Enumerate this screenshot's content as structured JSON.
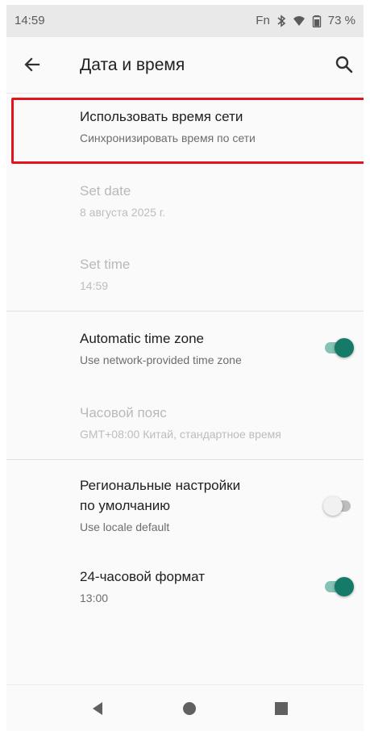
{
  "status_bar": {
    "time": "14:59",
    "fn_label": "Fn",
    "battery_percent": "73 %",
    "icons": [
      "bluetooth-icon",
      "wifi-icon",
      "battery-icon"
    ]
  },
  "toolbar": {
    "title": "Дата и время",
    "back_icon": "arrow-back-icon",
    "search_icon": "search-icon"
  },
  "settings": {
    "network_time": {
      "title": "Использовать время сети",
      "summary": "Синхронизировать время по сети"
    },
    "set_date": {
      "title": "Set date",
      "summary": "8 августа 2025 г.",
      "enabled": false
    },
    "set_time": {
      "title": "Set time",
      "summary": "14:59",
      "enabled": false
    },
    "auto_timezone": {
      "title": "Automatic time zone",
      "summary": "Use network-provided time zone",
      "checked": true
    },
    "timezone": {
      "title": "Часовой пояс",
      "summary": "GMT+08:00 Китай, стандартное время",
      "enabled": false
    },
    "regional": {
      "title_line1": "Региональные настройки",
      "title_line2": "по умолчанию",
      "summary": "Use locale default",
      "checked": false
    },
    "hour24": {
      "title": "24-часовой формат",
      "summary": "13:00",
      "checked": true
    }
  },
  "colors": {
    "accent": "#157a68",
    "highlight": "#e3141b"
  },
  "nav_bar": {
    "icons": [
      "back-triangle-icon",
      "home-circle-icon",
      "recents-square-icon"
    ]
  }
}
